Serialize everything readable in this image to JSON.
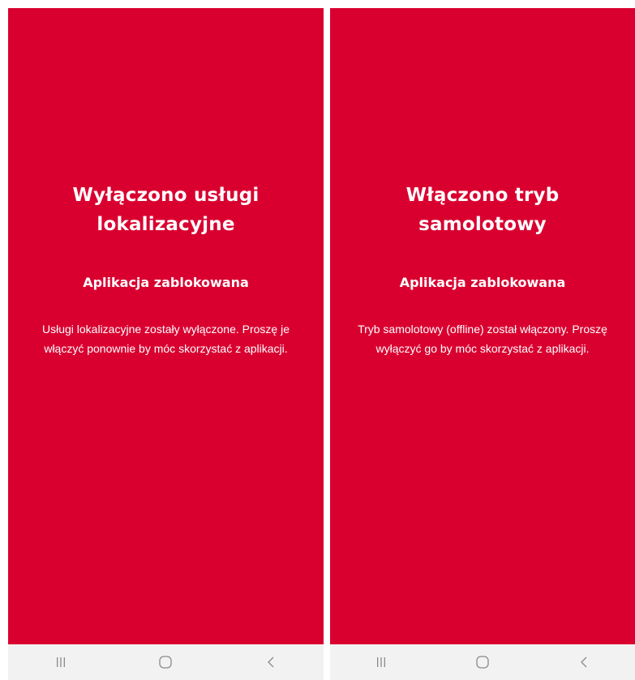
{
  "colors": {
    "panel_background": "#d90030",
    "text": "#ffffff",
    "navbar_background": "#f2f2f2",
    "navbar_icon": "#8a8a8a"
  },
  "screens": [
    {
      "title": "Wyłączono usługi lokalizacyjne",
      "subtitle": "Aplikacja zablokowana",
      "message": "Usługi lokalizacyjne zostały wyłączone. Proszę je włączyć ponownie by móc skorzystać z aplikacji."
    },
    {
      "title": "Włączono tryb samolotowy",
      "subtitle": "Aplikacja zablokowana",
      "message": "Tryb samolotowy (offline) został włączony. Proszę wyłączyć go by móc skorzystać z aplikacji."
    }
  ],
  "navbar": {
    "icons": [
      "recent-apps-icon",
      "home-icon",
      "back-icon"
    ]
  }
}
